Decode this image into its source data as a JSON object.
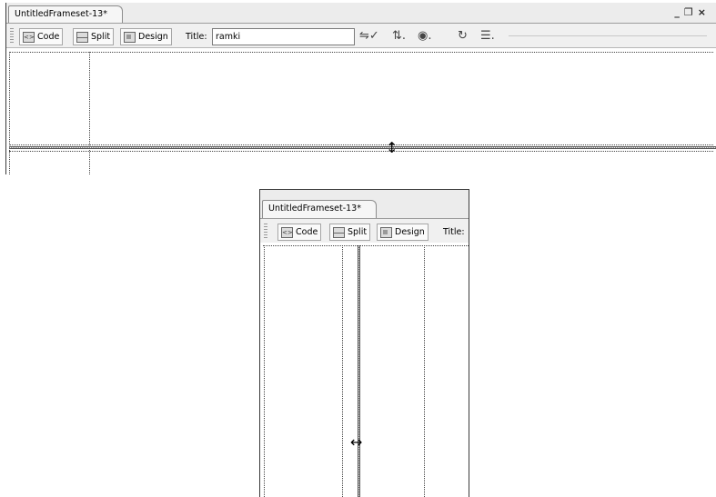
{
  "document": {
    "tab_title": "UntitledFrameset-13*"
  },
  "window_controls": {
    "minimize": "_",
    "restore": "❐",
    "close": "×"
  },
  "toolbar": {
    "code_label": "Code",
    "split_label": "Split",
    "design_label": "Design",
    "title_label": "Title:",
    "title_value": "ramki"
  },
  "icons": {
    "validate": "validate-markup-icon",
    "file_management": "file-management-icon",
    "preview": "preview-browser-icon",
    "refresh": "refresh-icon",
    "view_options": "view-options-icon"
  },
  "cursors": {
    "row_resize": "↕",
    "col_resize": "↔"
  }
}
